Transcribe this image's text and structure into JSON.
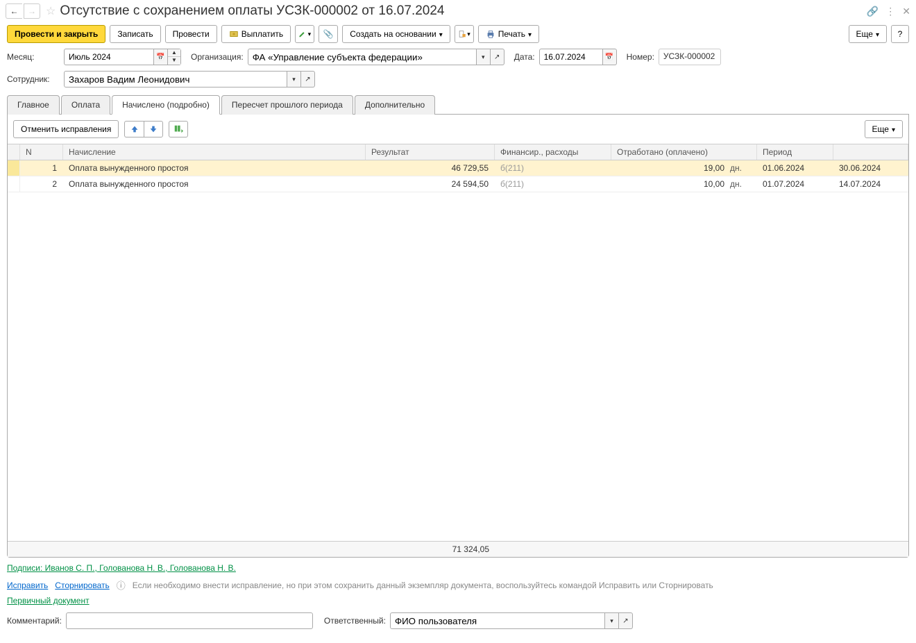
{
  "header": {
    "title": "Отсутствие с сохранением оплаты УСЗК-000002 от 16.07.2024"
  },
  "toolbar": {
    "post_and_close": "Провести и закрыть",
    "record": "Записать",
    "post": "Провести",
    "pay": "Выплатить",
    "create_based": "Создать на основании",
    "print": "Печать",
    "more": "Еще",
    "help": "?"
  },
  "form": {
    "month_label": "Месяц:",
    "month_value": "Июль 2024",
    "org_label": "Организация:",
    "org_value": "ФА «Управление субъекта федерации»",
    "date_label": "Дата:",
    "date_value": "16.07.2024",
    "number_label": "Номер:",
    "number_value": "УСЗК-000002",
    "employee_label": "Сотрудник:",
    "employee_value": "Захаров Вадим Леонидович"
  },
  "tabs": [
    {
      "label": "Главное"
    },
    {
      "label": "Оплата"
    },
    {
      "label": "Начислено (подробно)"
    },
    {
      "label": "Пересчет прошлого периода"
    },
    {
      "label": "Дополнительно"
    }
  ],
  "tab_toolbar": {
    "cancel_fixes": "Отменить исправления",
    "more": "Еще"
  },
  "table": {
    "headers": {
      "n": "N",
      "name": "Начисление",
      "result": "Результат",
      "fin": "Финансир., расходы",
      "worked": "Отработано (оплачено)",
      "period": "Период"
    },
    "rows": [
      {
        "n": "1",
        "name": "Оплата вынужденного простоя",
        "result": "46 729,55",
        "fin": "б(211)",
        "worked": "19,00",
        "unit": "дн.",
        "period1": "01.06.2024",
        "period2": "30.06.2024",
        "highlight": true
      },
      {
        "n": "2",
        "name": "Оплата вынужденного простоя",
        "result": "24 594,50",
        "fin": "б(211)",
        "worked": "10,00",
        "unit": "дн.",
        "period1": "01.07.2024",
        "period2": "14.07.2024",
        "highlight": false
      }
    ],
    "footer": {
      "total": "71 324,05"
    }
  },
  "footer": {
    "signatures": "Подписи: Иванов С. П., Голованова Н. В., Голованова Н. В.",
    "fix": "Исправить",
    "reverse": "Сторнировать",
    "hint": "Если необходимо внести исправление, но при этом сохранить данный экземпляр документа, воспользуйтесь командой Исправить или Сторнировать",
    "primary_doc": "Первичный документ",
    "comment_label": "Комментарий:",
    "comment_value": "",
    "responsible_label": "Ответственный:",
    "responsible_value": "ФИО пользователя"
  }
}
